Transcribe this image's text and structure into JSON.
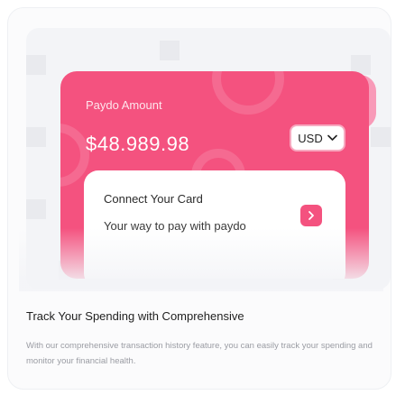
{
  "card": {
    "label": "Paydo Amount",
    "amount": "$48.989.98",
    "currency": "USD",
    "accent_color": "#f4527f"
  },
  "connect_panel": {
    "title": "Connect Your Card",
    "subtitle": "Your way to pay with paydo",
    "action_icon": "chevron-right-icon"
  },
  "feature": {
    "heading": "Track Your Spending with Comprehensive",
    "description": "With our comprehensive transaction history feature, you can easily track your spending and monitor your financial health."
  }
}
